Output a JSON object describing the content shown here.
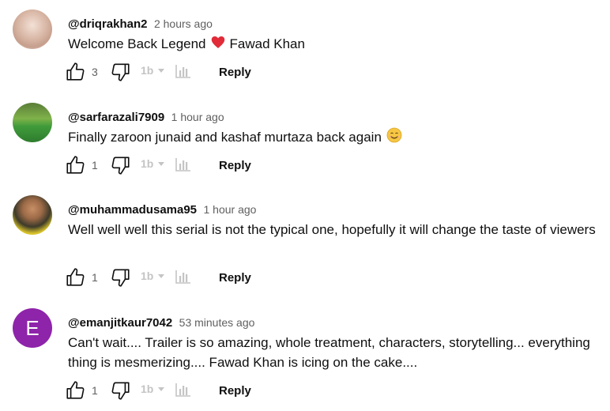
{
  "comments": [
    {
      "author": "@driqrakhan2",
      "time": "2 hours ago",
      "text_before": "Welcome Back Legend",
      "text_after": "Fawad Khan",
      "emoji": "red-heart",
      "likes": "3",
      "reply_label": "Reply"
    },
    {
      "author": "@sarfarazali7909",
      "time": "1 hour ago",
      "text_before": "Finally zaroon junaid and kashaf murtaza back again",
      "emoji": "smiling-face",
      "likes": "1",
      "reply_label": "Reply"
    },
    {
      "author": "@muhammadusama95",
      "time": "1 hour ago",
      "text_before": "Well well well this serial is not the typical one, hopefully it will change the taste of viewers",
      "likes": "1",
      "reply_label": "Reply"
    },
    {
      "author": "@emanjitkaur7042",
      "time": "53 minutes ago",
      "avatar_letter": "E",
      "avatar_color": "#8e24aa",
      "text_before": "Can't wait.... Trailer is so amazing, whole treatment, characters, storytelling... everything thing is mesmerizing.... Fawad Khan is icing on the cake....",
      "likes": "1",
      "reply_label": "Reply"
    }
  ]
}
